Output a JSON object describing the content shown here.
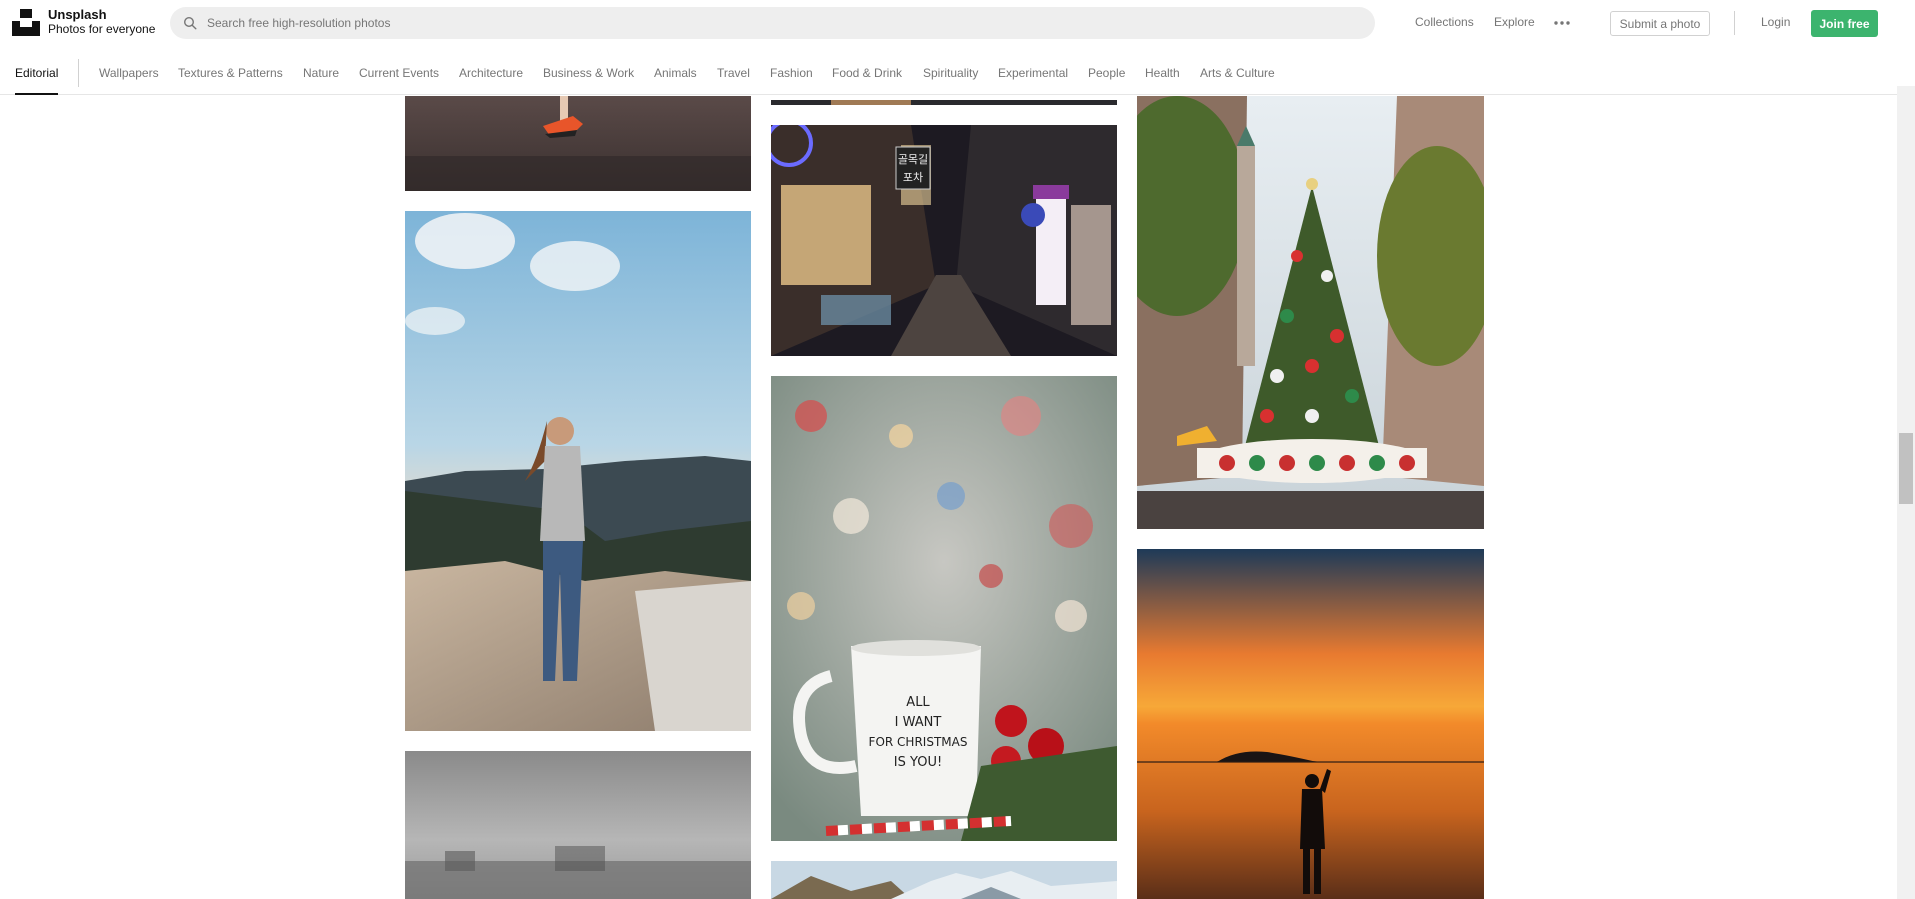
{
  "header": {
    "brand_name": "Unsplash",
    "brand_tagline": "Photos for everyone",
    "search_placeholder": "Search free high-resolution photos",
    "nav": {
      "collections": "Collections",
      "explore": "Explore"
    },
    "submit_label": "Submit a photo",
    "login_label": "Login",
    "join_label": "Join free",
    "accent_color": "#3cb46e"
  },
  "topics": {
    "active": "Editorial",
    "items": [
      "Wallpapers",
      "Textures & Patterns",
      "Nature",
      "Current Events",
      "Architecture",
      "Business & Work",
      "Animals",
      "Travel",
      "Fashion",
      "Food & Drink",
      "Spirituality",
      "Experimental",
      "People",
      "Health",
      "Arts & Culture"
    ]
  },
  "photos": {
    "mug_text": [
      "ALL",
      "I WANT",
      "FOR CHRISTMAS",
      "IS YOU!"
    ],
    "street_sign_lines": [
      "골목길",
      "포차"
    ]
  }
}
